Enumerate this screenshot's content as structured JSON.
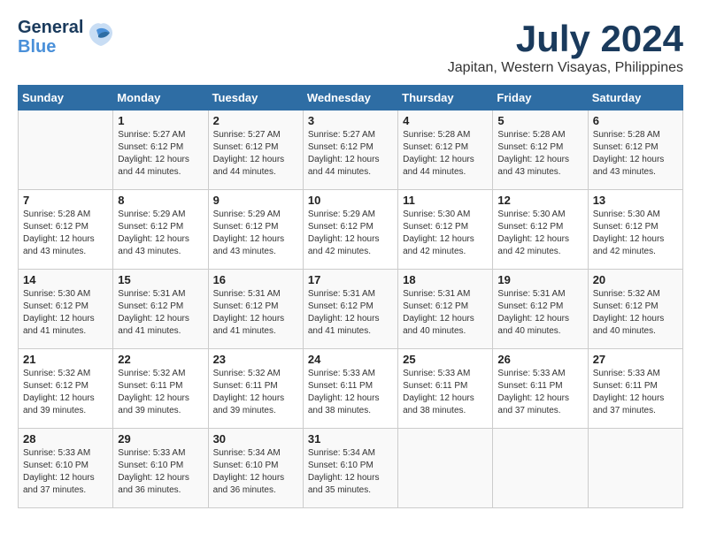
{
  "logo": {
    "line1": "General",
    "line2": "Blue"
  },
  "header": {
    "month_year": "July 2024",
    "location": "Japitan, Western Visayas, Philippines"
  },
  "days_of_week": [
    "Sunday",
    "Monday",
    "Tuesday",
    "Wednesday",
    "Thursday",
    "Friday",
    "Saturday"
  ],
  "weeks": [
    [
      {
        "day": "",
        "info": ""
      },
      {
        "day": "1",
        "info": "Sunrise: 5:27 AM\nSunset: 6:12 PM\nDaylight: 12 hours\nand 44 minutes."
      },
      {
        "day": "2",
        "info": "Sunrise: 5:27 AM\nSunset: 6:12 PM\nDaylight: 12 hours\nand 44 minutes."
      },
      {
        "day": "3",
        "info": "Sunrise: 5:27 AM\nSunset: 6:12 PM\nDaylight: 12 hours\nand 44 minutes."
      },
      {
        "day": "4",
        "info": "Sunrise: 5:28 AM\nSunset: 6:12 PM\nDaylight: 12 hours\nand 44 minutes."
      },
      {
        "day": "5",
        "info": "Sunrise: 5:28 AM\nSunset: 6:12 PM\nDaylight: 12 hours\nand 43 minutes."
      },
      {
        "day": "6",
        "info": "Sunrise: 5:28 AM\nSunset: 6:12 PM\nDaylight: 12 hours\nand 43 minutes."
      }
    ],
    [
      {
        "day": "7",
        "info": "Sunrise: 5:28 AM\nSunset: 6:12 PM\nDaylight: 12 hours\nand 43 minutes."
      },
      {
        "day": "8",
        "info": "Sunrise: 5:29 AM\nSunset: 6:12 PM\nDaylight: 12 hours\nand 43 minutes."
      },
      {
        "day": "9",
        "info": "Sunrise: 5:29 AM\nSunset: 6:12 PM\nDaylight: 12 hours\nand 43 minutes."
      },
      {
        "day": "10",
        "info": "Sunrise: 5:29 AM\nSunset: 6:12 PM\nDaylight: 12 hours\nand 42 minutes."
      },
      {
        "day": "11",
        "info": "Sunrise: 5:30 AM\nSunset: 6:12 PM\nDaylight: 12 hours\nand 42 minutes."
      },
      {
        "day": "12",
        "info": "Sunrise: 5:30 AM\nSunset: 6:12 PM\nDaylight: 12 hours\nand 42 minutes."
      },
      {
        "day": "13",
        "info": "Sunrise: 5:30 AM\nSunset: 6:12 PM\nDaylight: 12 hours\nand 42 minutes."
      }
    ],
    [
      {
        "day": "14",
        "info": "Sunrise: 5:30 AM\nSunset: 6:12 PM\nDaylight: 12 hours\nand 41 minutes."
      },
      {
        "day": "15",
        "info": "Sunrise: 5:31 AM\nSunset: 6:12 PM\nDaylight: 12 hours\nand 41 minutes."
      },
      {
        "day": "16",
        "info": "Sunrise: 5:31 AM\nSunset: 6:12 PM\nDaylight: 12 hours\nand 41 minutes."
      },
      {
        "day": "17",
        "info": "Sunrise: 5:31 AM\nSunset: 6:12 PM\nDaylight: 12 hours\nand 41 minutes."
      },
      {
        "day": "18",
        "info": "Sunrise: 5:31 AM\nSunset: 6:12 PM\nDaylight: 12 hours\nand 40 minutes."
      },
      {
        "day": "19",
        "info": "Sunrise: 5:31 AM\nSunset: 6:12 PM\nDaylight: 12 hours\nand 40 minutes."
      },
      {
        "day": "20",
        "info": "Sunrise: 5:32 AM\nSunset: 6:12 PM\nDaylight: 12 hours\nand 40 minutes."
      }
    ],
    [
      {
        "day": "21",
        "info": "Sunrise: 5:32 AM\nSunset: 6:12 PM\nDaylight: 12 hours\nand 39 minutes."
      },
      {
        "day": "22",
        "info": "Sunrise: 5:32 AM\nSunset: 6:11 PM\nDaylight: 12 hours\nand 39 minutes."
      },
      {
        "day": "23",
        "info": "Sunrise: 5:32 AM\nSunset: 6:11 PM\nDaylight: 12 hours\nand 39 minutes."
      },
      {
        "day": "24",
        "info": "Sunrise: 5:33 AM\nSunset: 6:11 PM\nDaylight: 12 hours\nand 38 minutes."
      },
      {
        "day": "25",
        "info": "Sunrise: 5:33 AM\nSunset: 6:11 PM\nDaylight: 12 hours\nand 38 minutes."
      },
      {
        "day": "26",
        "info": "Sunrise: 5:33 AM\nSunset: 6:11 PM\nDaylight: 12 hours\nand 37 minutes."
      },
      {
        "day": "27",
        "info": "Sunrise: 5:33 AM\nSunset: 6:11 PM\nDaylight: 12 hours\nand 37 minutes."
      }
    ],
    [
      {
        "day": "28",
        "info": "Sunrise: 5:33 AM\nSunset: 6:10 PM\nDaylight: 12 hours\nand 37 minutes."
      },
      {
        "day": "29",
        "info": "Sunrise: 5:33 AM\nSunset: 6:10 PM\nDaylight: 12 hours\nand 36 minutes."
      },
      {
        "day": "30",
        "info": "Sunrise: 5:34 AM\nSunset: 6:10 PM\nDaylight: 12 hours\nand 36 minutes."
      },
      {
        "day": "31",
        "info": "Sunrise: 5:34 AM\nSunset: 6:10 PM\nDaylight: 12 hours\nand 35 minutes."
      },
      {
        "day": "",
        "info": ""
      },
      {
        "day": "",
        "info": ""
      },
      {
        "day": "",
        "info": ""
      }
    ]
  ]
}
